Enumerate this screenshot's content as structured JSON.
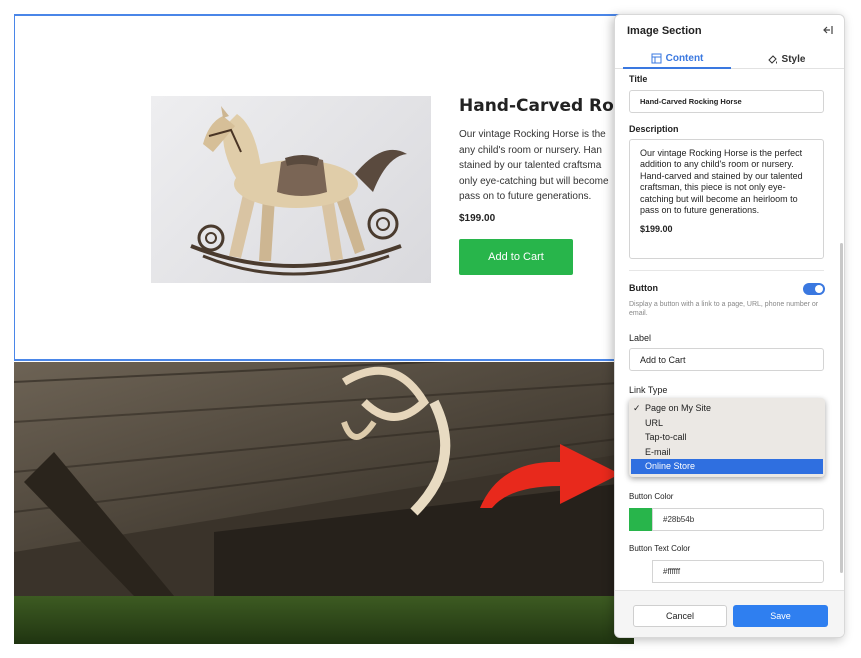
{
  "preview": {
    "product_title": "Hand-Carved Rock",
    "description_lines": [
      "Our vintage Rocking Horse is the",
      "any child's room or nursery. Han",
      "stained by our talented craftsma",
      "only eye-catching but will become",
      "pass on to future generations."
    ],
    "price": "$199.00",
    "button_label": "Add to Cart",
    "button_color": "#28b54b"
  },
  "panel": {
    "title": "Image Section",
    "tabs": [
      {
        "label": "Content",
        "active": true
      },
      {
        "label": "Style",
        "active": false
      }
    ],
    "title_field": {
      "label": "Title",
      "value": "Hand-Carved Rocking Horse"
    },
    "description_field": {
      "label": "Description",
      "text": "Our vintage Rocking Horse is the perfect addition to any child's room or nursery. Hand-carved and stained by our talented craftsman, this piece is not only eye-catching but will become an heirloom to pass on to future generations.",
      "price": "$199.00"
    },
    "button_section": {
      "label": "Button",
      "toggle_on": true,
      "help": "Display a button with a link to a page, URL, phone number or email."
    },
    "label_field": {
      "label": "Label",
      "value": "Add to Cart"
    },
    "link_type": {
      "label": "Link Type",
      "options": [
        "Page on My Site",
        "URL",
        "Tap-to-call",
        "E-mail",
        "Online Store"
      ],
      "checked": "Page on My Site",
      "highlighted": "Online Store"
    },
    "button_color": {
      "label": "Button Color",
      "value": "#28b54b"
    },
    "button_text_color": {
      "label": "Button Text Color",
      "value": "#ffffff"
    },
    "footer": {
      "cancel": "Cancel",
      "save": "Save"
    },
    "accent_color": "#3a78e0"
  }
}
